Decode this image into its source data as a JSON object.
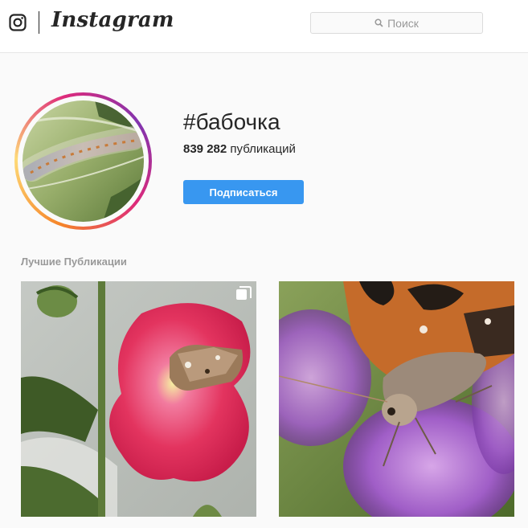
{
  "header": {
    "logo_icon": "instagram-camera-icon",
    "wordmark": "Instagram",
    "search": {
      "icon": "search-icon",
      "placeholder": "Поиск"
    }
  },
  "profile": {
    "hashtag": "#бабочка",
    "post_count": "839 282",
    "post_count_label": "публикаций",
    "follow_label": "Подписаться",
    "avatar_alt": "caterpillar"
  },
  "top_posts": {
    "title": "Лучшие Публикации",
    "items": [
      {
        "alt": "butterfly on pink hollyhock flower",
        "multi_icon": "carousel-icon"
      },
      {
        "alt": "butterfly on purple chive flower"
      }
    ]
  },
  "colors": {
    "accent": "#3897f0",
    "text": "#262626",
    "muted": "#999999",
    "background": "#fafafa"
  }
}
